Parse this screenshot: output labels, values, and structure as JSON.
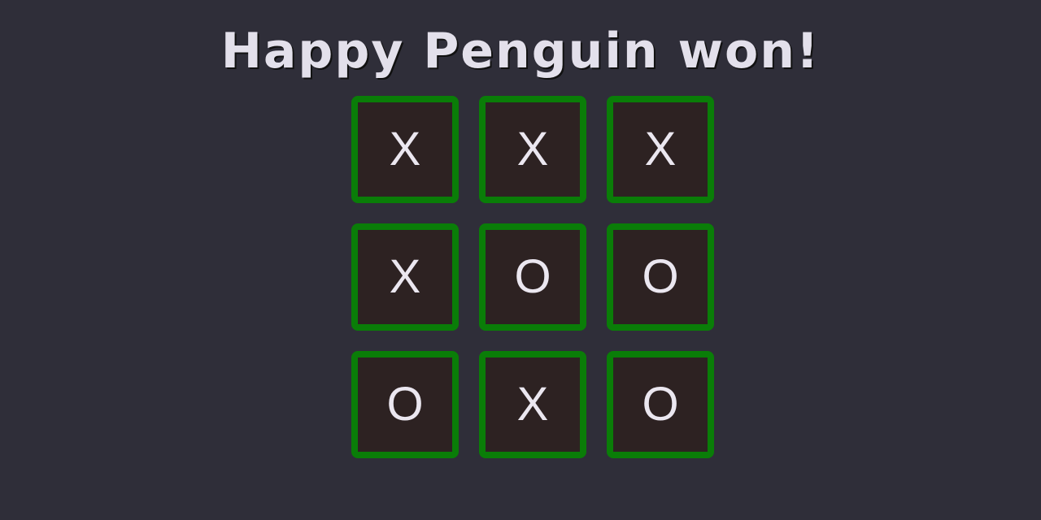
{
  "status": {
    "message": "Happy Penguin won!"
  },
  "board": {
    "cells": [
      "X",
      "X",
      "X",
      "X",
      "O",
      "O",
      "O",
      "X",
      "O"
    ]
  },
  "colors": {
    "background": "#2f2e39",
    "cell_border": "#0a7d08",
    "cell_fill": "#2d2222",
    "text": "#ebe7f0"
  }
}
